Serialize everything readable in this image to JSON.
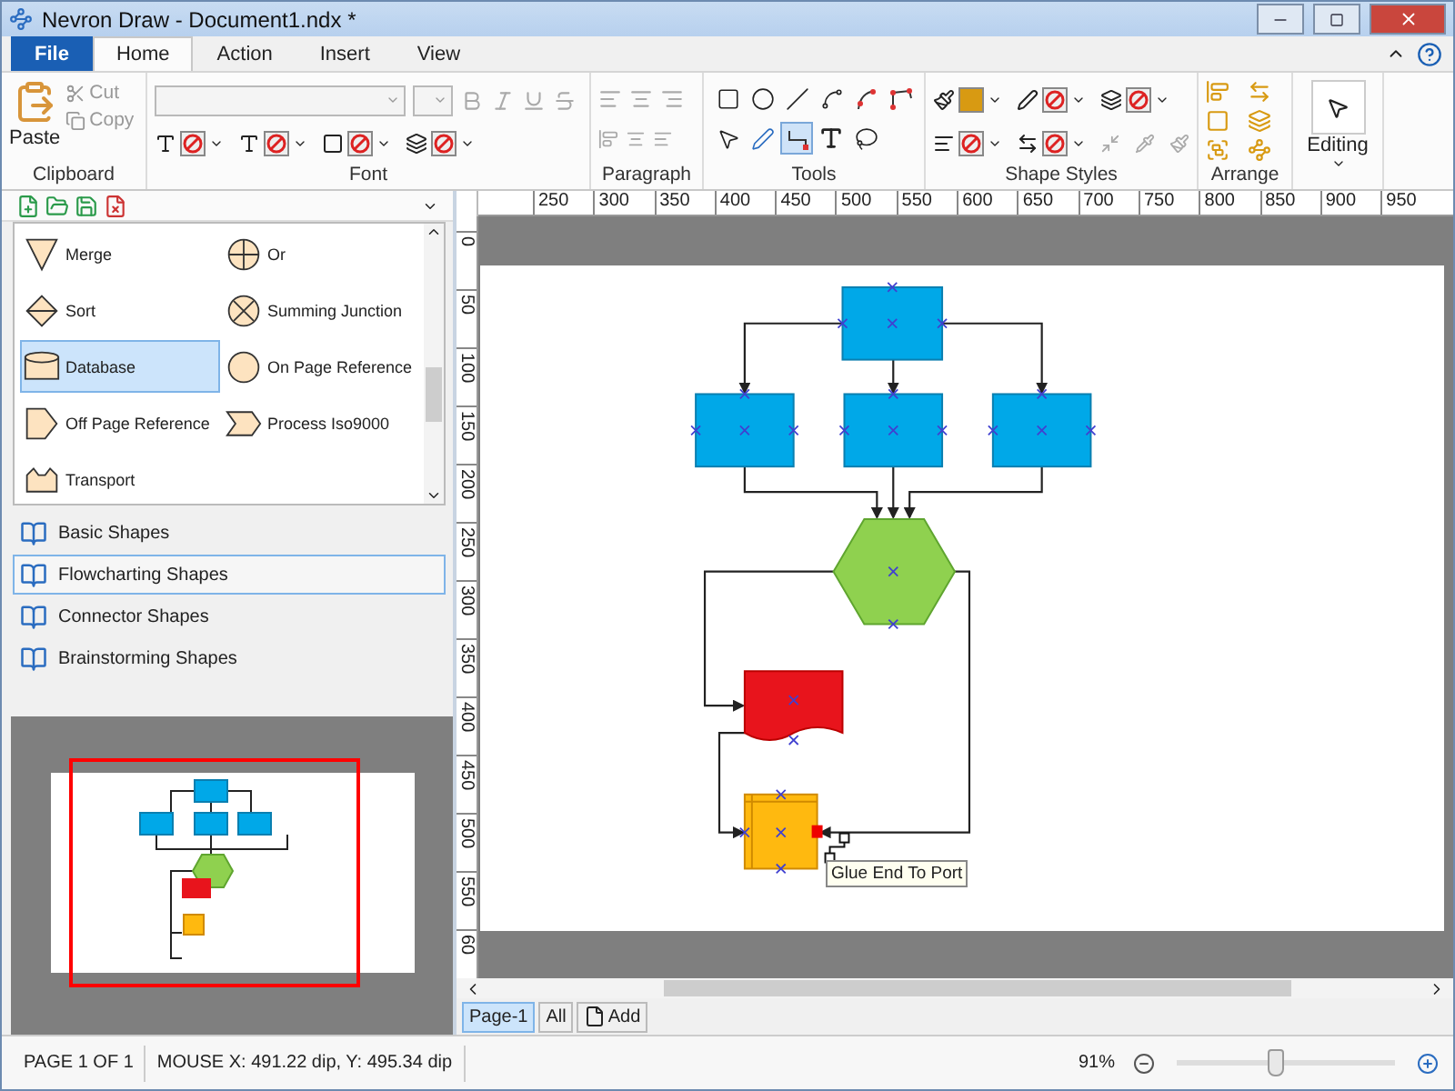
{
  "window": {
    "title": "Nevron Draw - Document1.ndx *"
  },
  "menu_tabs": [
    {
      "label": "File",
      "kind": "file",
      "selected": false
    },
    {
      "label": "Home",
      "kind": "tab",
      "selected": true
    },
    {
      "label": "Action",
      "kind": "tab",
      "selected": false
    },
    {
      "label": "Insert",
      "kind": "tab",
      "selected": false
    },
    {
      "label": "View",
      "kind": "tab",
      "selected": false
    }
  ],
  "ribbon": {
    "clipboard": {
      "label": "Clipboard",
      "paste": "Paste",
      "cut": {
        "label": "Cut",
        "disabled": true
      },
      "copy": {
        "label": "Copy",
        "disabled": true
      }
    },
    "font": {
      "label": "Font",
      "format_buttons": [
        {
          "kind": "bold",
          "disabled": true
        },
        {
          "kind": "italic",
          "disabled": true
        },
        {
          "kind": "underline",
          "disabled": true
        },
        {
          "kind": "strike",
          "disabled": true
        }
      ]
    },
    "paragraph": {
      "label": "Paragraph"
    },
    "tools": {
      "label": "Tools",
      "items": [
        {
          "kind": "rectangle",
          "selected": false
        },
        {
          "kind": "ellipse",
          "selected": false
        },
        {
          "kind": "line",
          "selected": false
        },
        {
          "kind": "curve",
          "selected": false
        },
        {
          "kind": "arc",
          "selected": false
        },
        {
          "kind": "polyline",
          "selected": false
        },
        {
          "kind": "pointer",
          "selected": false
        },
        {
          "kind": "pen",
          "selected": false
        },
        {
          "kind": "connector",
          "selected": true
        },
        {
          "kind": "text",
          "selected": false
        },
        {
          "kind": "lasso",
          "selected": false
        }
      ]
    },
    "shape_styles": {
      "label": "Shape Styles"
    },
    "arrange": {
      "label": "Arrange"
    },
    "editing": {
      "label": "Editing"
    }
  },
  "shapes": [
    {
      "label": "Merge",
      "kind": "merge",
      "selected": false
    },
    {
      "label": "Or",
      "kind": "or",
      "selected": false
    },
    {
      "label": "Sort",
      "kind": "sort",
      "selected": false
    },
    {
      "label": "Summing Junction",
      "kind": "summing",
      "selected": false
    },
    {
      "label": "Database",
      "kind": "database",
      "selected": true
    },
    {
      "label": "On Page Reference",
      "kind": "circle",
      "selected": false
    },
    {
      "label": "Off Page Reference",
      "kind": "offpage",
      "selected": false
    },
    {
      "label": "Process Iso9000",
      "kind": "chevron",
      "selected": false
    },
    {
      "label": "Transport",
      "kind": "transport",
      "selected": false
    }
  ],
  "libraries": [
    {
      "label": "Basic Shapes",
      "selected": false
    },
    {
      "label": "Flowcharting Shapes",
      "selected": true
    },
    {
      "label": "Connector Shapes",
      "selected": false
    },
    {
      "label": "Brainstorming Shapes",
      "selected": false
    }
  ],
  "ruler": {
    "horizontal": [
      "250",
      "300",
      "350",
      "400",
      "450",
      "500",
      "550",
      "600",
      "650",
      "700",
      "750",
      "800",
      "850",
      "900",
      "950"
    ],
    "vertical": [
      "0",
      "50",
      "100",
      "150",
      "200",
      "250",
      "300",
      "350",
      "400",
      "450",
      "500",
      "550",
      "60"
    ]
  },
  "canvas": {
    "tooltip": "Glue End To Port"
  },
  "page_tabs": [
    {
      "label": "Page-1",
      "kind": "page",
      "selected": true
    },
    {
      "label": "All",
      "kind": "all",
      "selected": false
    },
    {
      "label": "Add",
      "kind": "add",
      "selected": false
    }
  ],
  "status_bar": {
    "page": "PAGE 1 OF 1",
    "mouse": "MOUSE X: 491.22 dip, Y: 495.34 dip",
    "zoom": "91%",
    "zoom_slider": {
      "level": 0.45
    }
  }
}
